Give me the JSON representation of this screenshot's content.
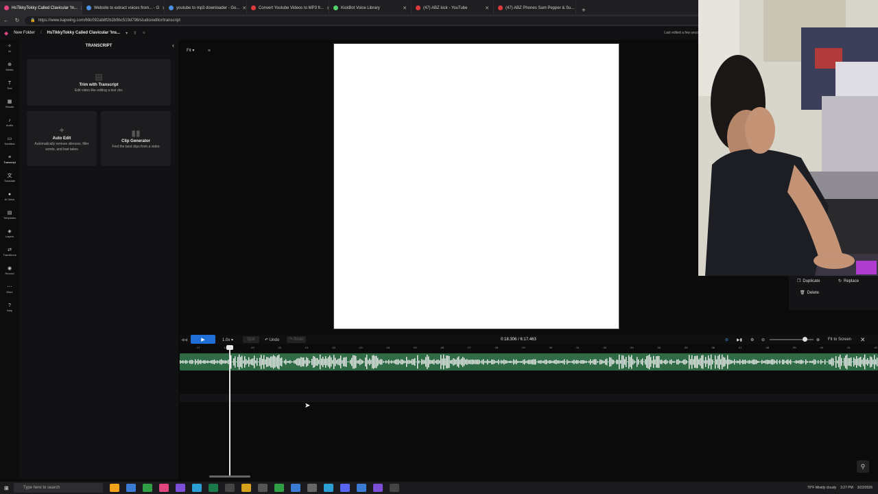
{
  "browser": {
    "tabs": [
      {
        "label": "HsTikkyTokky Called Clavicular 'In...",
        "active": true,
        "color": "#e0457b"
      },
      {
        "label": "Website to extract voices from... - G",
        "active": false,
        "color": "#4a90e2"
      },
      {
        "label": "youtube to mp3 downloader - Go...",
        "active": false,
        "color": "#4a90e2"
      },
      {
        "label": "Convert Youtube Videos to MP3 fr...",
        "active": false,
        "color": "#e03b3b"
      },
      {
        "label": "KickBot Voice Library",
        "active": false,
        "color": "#53d16b"
      },
      {
        "label": "(47) ABZ kick - YouTube",
        "active": false,
        "color": "#e03b3b"
      },
      {
        "label": "(47) ABZ Phones Sam Pepper & Su...",
        "active": false,
        "color": "#e03b3b"
      }
    ],
    "new_tab": "+",
    "url": "https://www.kapwing.com/69c092ab8f2b2b9bc519d798/studio/editor/transcript"
  },
  "app_header": {
    "folder": "New Folder",
    "project_title": "HsTikkyTokky Called Clavicular 'Ins...",
    "status": "Last edited a few seco"
  },
  "rail": [
    {
      "label": "AI",
      "icon": "sparkle-icon"
    },
    {
      "label": "Media",
      "icon": "plus-icon"
    },
    {
      "label": "Text",
      "icon": "text-icon"
    },
    {
      "label": "Visuals",
      "icon": "grid-icon"
    },
    {
      "label": "Audio",
      "icon": "music-icon"
    },
    {
      "label": "Subtitles",
      "icon": "subtitles-icon"
    },
    {
      "label": "Transcript",
      "icon": "transcript-icon"
    },
    {
      "label": "Translate",
      "icon": "translate-icon"
    },
    {
      "label": "AI Voice",
      "icon": "mic-icon"
    },
    {
      "label": "Templates",
      "icon": "template-icon"
    },
    {
      "label": "Layers",
      "icon": "layers-icon"
    },
    {
      "label": "Transitions",
      "icon": "transition-icon"
    },
    {
      "label": "Record",
      "icon": "record-icon"
    },
    {
      "label": "More",
      "icon": "more-icon"
    },
    {
      "label": "Help",
      "icon": "help-icon"
    }
  ],
  "panel": {
    "title": "TRANSCRIPT",
    "trim_card": {
      "title": "Trim with Transcript",
      "subtitle": "Edit video like editing a text doc"
    },
    "auto_edit_card": {
      "title": "Auto Edit",
      "subtitle_1": "Automatically remove silences, filler",
      "subtitle_2": "words, and bad takes"
    },
    "clip_card": {
      "title": "Clip Generator",
      "subtitle": "Find the best clips from a video"
    }
  },
  "canvas": {
    "fit_label": "Fit"
  },
  "context_menu": {
    "duplicate": "Duplicate",
    "replace": "Replace",
    "delete": "Delete"
  },
  "timeline": {
    "speed": "1.0x",
    "split": "Split",
    "undo": "Undo",
    "redo": "Redo",
    "time": "0:18.306 / 6:17.463",
    "fit_to_screen": "Fit to Screen",
    "ticks": [
      ":17",
      ":18",
      ":19",
      ":20",
      ":21",
      ":22",
      ":23",
      ":24",
      ":25",
      ":26",
      ":27",
      ":28",
      ":29",
      ":30",
      ":31",
      ":32",
      ":33",
      ":34",
      ":35",
      ":36",
      ":37",
      ":38",
      ":39",
      ":40",
      ":41",
      ":42",
      ":43"
    ],
    "zoom_level": 0.79
  },
  "taskbar": {
    "search_placeholder": "Type here to search",
    "weather": "70°F Mostly cloudy",
    "time": "3:27 PM",
    "date": "3/22/2026"
  },
  "colors": {
    "accent": "#1f6fd6",
    "audio_track": "#2f6b45"
  }
}
